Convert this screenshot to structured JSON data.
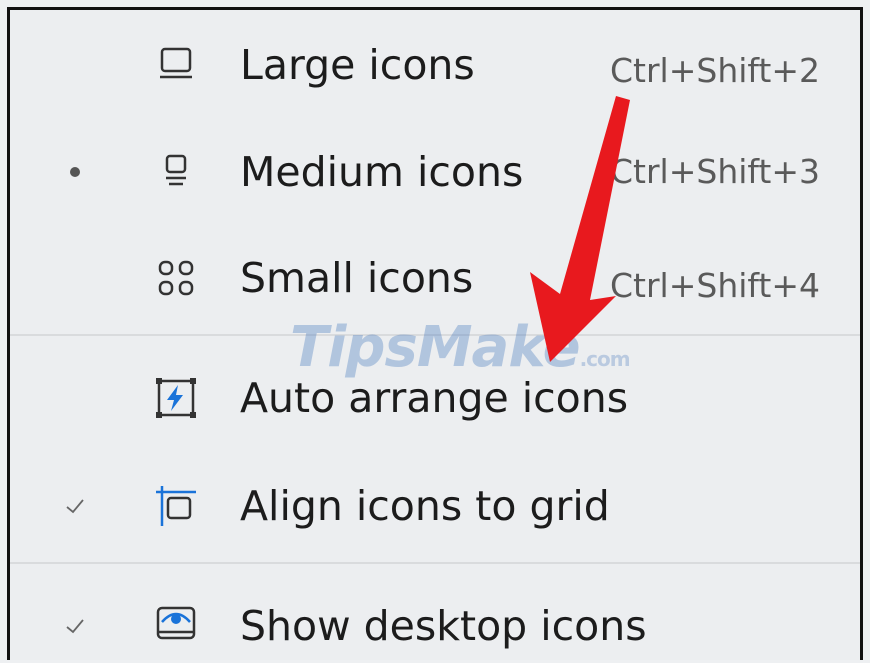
{
  "menu": {
    "items": [
      {
        "label": "Large icons",
        "shortcut": "Ctrl+Shift+2",
        "icon": "large-icons-icon",
        "state": ""
      },
      {
        "label": "Medium icons",
        "shortcut": "Ctrl+Shift+3",
        "icon": "medium-icons-icon",
        "state": "selected"
      },
      {
        "label": "Small icons",
        "shortcut": "Ctrl+Shift+4",
        "icon": "small-icons-icon",
        "state": ""
      },
      {
        "label": "Auto arrange icons",
        "icon": "auto-arrange-icon",
        "state": ""
      },
      {
        "label": "Align icons to grid",
        "icon": "align-grid-icon",
        "state": "checked"
      },
      {
        "label": "Show desktop icons",
        "icon": "show-desktop-icon",
        "state": "checked"
      }
    ]
  },
  "watermark": {
    "brand": "TipsMake",
    "domain": ".com"
  },
  "colors": {
    "background": "#eceef0",
    "accent": "#1a73d9",
    "arrow": "#e8191e"
  }
}
